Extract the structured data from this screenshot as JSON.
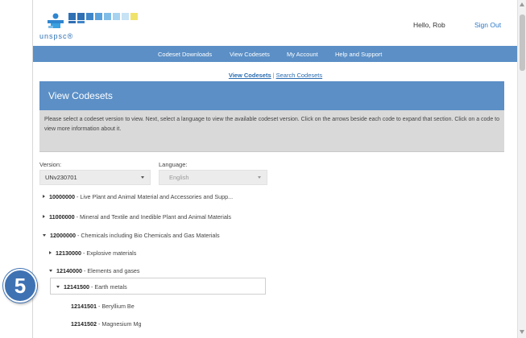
{
  "header": {
    "logo_text": "unspsc®",
    "user_greeting": "Hello, Rob",
    "signout_label": "Sign Out",
    "logo_colors": [
      "#2f6fb3",
      "#2f6fb3",
      "#3f86c9",
      "#5aa2dd",
      "#7fbde8",
      "#a6d3f0",
      "#c7e3f5",
      "#f0e36b"
    ]
  },
  "nav": {
    "items": [
      "Codeset Downloads",
      "View Codesets",
      "My Account",
      "Help and Support"
    ]
  },
  "subnav": {
    "view_codesets": "View Codesets",
    "separator": "|",
    "search_codesets": "Search Codesets"
  },
  "page_title": "View Codesets",
  "instructions": "Please select a codeset version to view. Next, select a language to view the available codeset version. Click on the arrows beside each code to expand that section. Click on a code to view more information about it.",
  "version": {
    "label": "Version:",
    "value": "UNv230701"
  },
  "language": {
    "label": "Language:",
    "value": "English"
  },
  "tree": [
    {
      "code": "10000000",
      "name": " - Live Plant and Animal Material and Accessories and Supp...",
      "expanded": false
    },
    {
      "code": "11000000",
      "name": " - Mineral and Textile and Inedible Plant and Animal Materials",
      "expanded": false
    },
    {
      "code": "12000000",
      "name": " - Chemicals including Bio Chemicals and Gas Materials",
      "expanded": true
    },
    {
      "code": "12130000",
      "name": " - Explosive materials",
      "expanded": false
    },
    {
      "code": "12140000",
      "name": " - Elements and gases",
      "expanded": true
    },
    {
      "code": "12141500",
      "name": " - Earth metals",
      "expanded": true
    },
    {
      "code": "12141501",
      "name": " - Beryllium Be"
    },
    {
      "code": "12141502",
      "name": " - Magnesium Mg"
    }
  ],
  "step_badge": "5",
  "colors": {
    "nav_blue": "#5b8fc6",
    "link_blue": "#2a6cb0",
    "badge_blue": "#3f72b3",
    "instructions_bg": "#d9d9d9"
  }
}
